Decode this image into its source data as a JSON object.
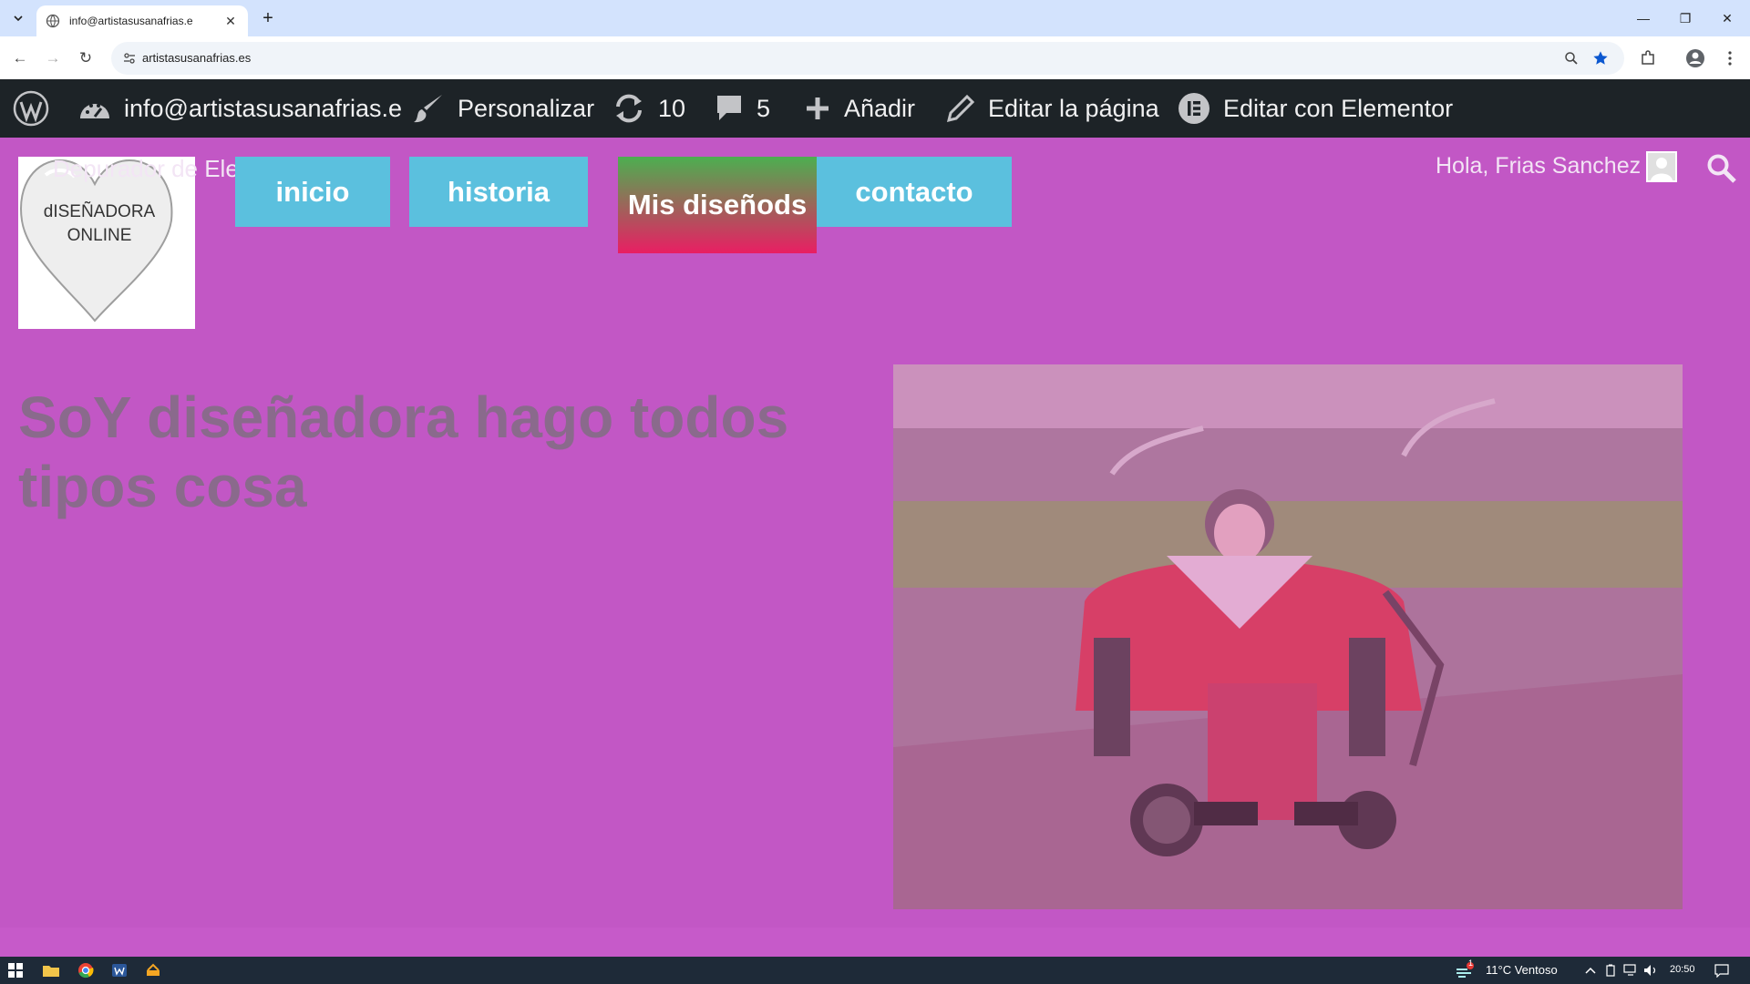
{
  "browser": {
    "tab_title": "info@artistasusanafrias.e",
    "url": "artistasusanafrias.es"
  },
  "adminbar": {
    "site_name": "info@artistasusanafrias.e",
    "customize_label": "Personalizar",
    "updates_count": "10",
    "comments_count": "5",
    "add_new_label": "Añadir",
    "edit_page_label": "Editar la página",
    "elementor_label": "Editar con Elementor"
  },
  "header": {
    "logo_text": "dISEÑADORA ONLINE",
    "ghost_title": "Depurador de Elementor",
    "menu": [
      {
        "label": "inicio"
      },
      {
        "label": "historia"
      },
      {
        "label": "Mis diseñods"
      },
      {
        "label": "contacto"
      }
    ],
    "greeting": "Hola, Frias Sanchez"
  },
  "main": {
    "heading": "SoY diseñadora hago todos tipos cosa"
  },
  "taskbar": {
    "weather": "11°C  Ventoso",
    "notification_count": "1",
    "time": "20:50"
  },
  "colors": {
    "page_bg": "#c257c5",
    "menu_button": "#5bc0de",
    "menu_active_top": "#4caf50",
    "menu_active_bottom": "#e91e63",
    "adminbar_bg": "#1d2327"
  }
}
